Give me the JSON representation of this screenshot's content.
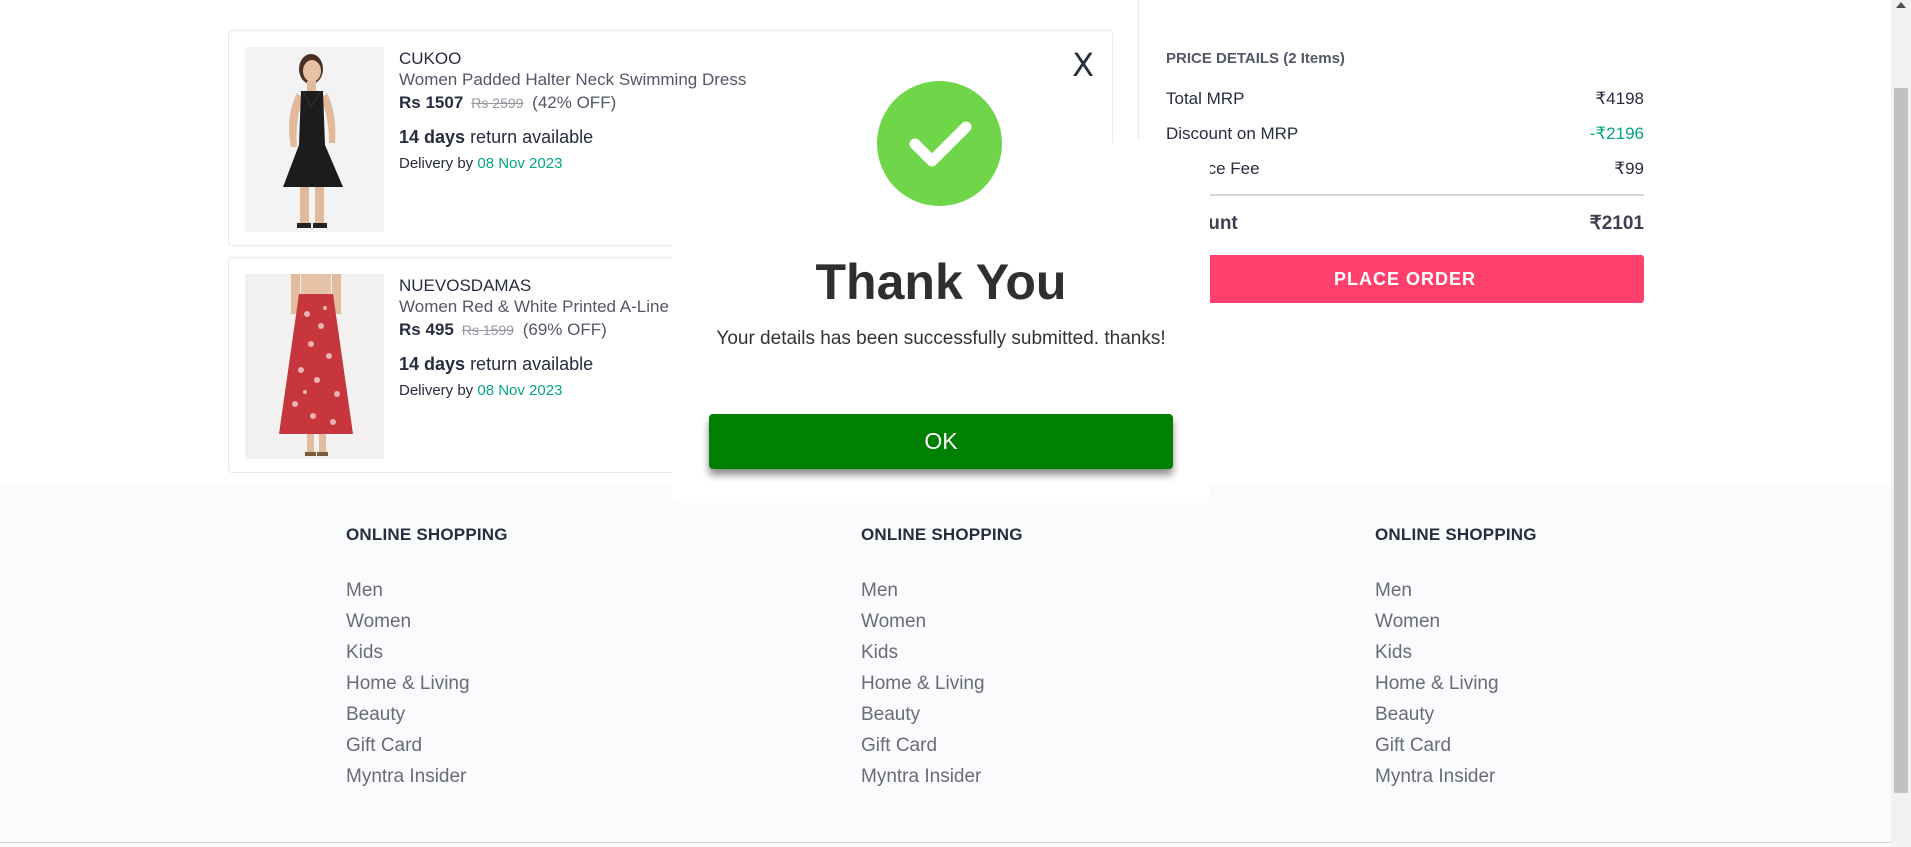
{
  "cart": {
    "items": [
      {
        "brand": "CUKOO",
        "name": "Women Padded Halter Neck Swimming Dress",
        "price": "Rs 1507",
        "mrp": "Rs 2599",
        "discount": "(42% OFF)",
        "return_days": "14 days",
        "return_text": " return available",
        "delivery_label": "Delivery by ",
        "delivery_date": "08 Nov 2023"
      },
      {
        "brand": "NUEVOSDAMAS",
        "name": "Women Red & White Printed A-Line",
        "price": "Rs 495",
        "mrp": "Rs 1599",
        "discount": "(69% OFF)",
        "return_days": "14 days",
        "return_text": " return available",
        "delivery_label": "Delivery by ",
        "delivery_date": "08 Nov 2023"
      }
    ],
    "remove_label": "X"
  },
  "price_details": {
    "title": "PRICE DETAILS (2 Items)",
    "rows": [
      {
        "label": "Total MRP",
        "value": "₹4198"
      },
      {
        "label": "Discount on MRP",
        "value": "-₹2196"
      },
      {
        "label": "enience Fee",
        "value": "₹99"
      }
    ],
    "total_label": "Amount",
    "total_value": "₹2101",
    "place_order": "PLACE ORDER"
  },
  "modal": {
    "title": "Thank You",
    "message": "Your details has been successfully submitted. thanks!",
    "ok": "OK",
    "success_color": "#6fd649",
    "button_color": "#008000"
  },
  "footer": {
    "columns": [
      {
        "heading": "ONLINE SHOPPING",
        "links": [
          "Men",
          "Women",
          "Kids",
          "Home & Living",
          "Beauty",
          "Gift Card",
          "Myntra Insider"
        ]
      },
      {
        "heading": "ONLINE SHOPPING",
        "links": [
          "Men",
          "Women",
          "Kids",
          "Home & Living",
          "Beauty",
          "Gift Card",
          "Myntra Insider"
        ]
      },
      {
        "heading": "ONLINE SHOPPING",
        "links": [
          "Men",
          "Women",
          "Kids",
          "Home & Living",
          "Beauty",
          "Gift Card",
          "Myntra Insider"
        ]
      }
    ]
  },
  "colors": {
    "accent": "#ff3f6c",
    "discount_green": "#03a685"
  }
}
